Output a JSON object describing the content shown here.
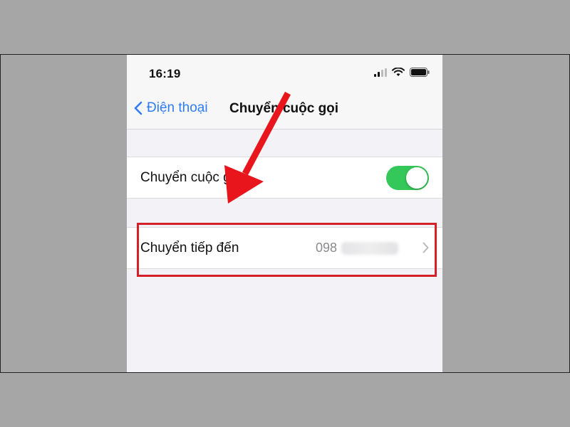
{
  "status_bar": {
    "time": "16:19",
    "icons": [
      "signal-icon",
      "wifi-icon",
      "battery-icon"
    ]
  },
  "nav": {
    "back_label": "Điện thoại",
    "title": "Chuyển cuộc gọi"
  },
  "settings": {
    "call_forwarding_label": "Chuyển cuộc gọi",
    "call_forwarding_enabled": true,
    "forward_to_label": "Chuyển tiếp đến",
    "forward_to_value": "098"
  },
  "colors": {
    "accent": "#2f7cf6",
    "toggle_on": "#34c759",
    "highlight": "#d42127",
    "background": "#a6a6a6"
  }
}
